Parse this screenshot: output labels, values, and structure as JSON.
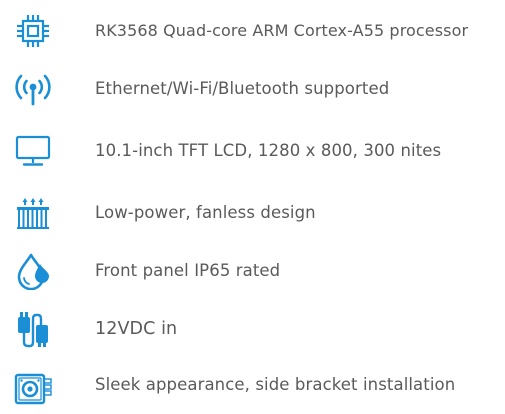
{
  "colors": {
    "icon": "#1a8fd6",
    "text": "#5a5a5a",
    "background": "#ffffff"
  },
  "features": [
    {
      "icon": "processor-chip-icon",
      "label": "RK3568 Quad-core ARM Cortex-A55 processor"
    },
    {
      "icon": "wireless-antenna-icon",
      "label": "Ethernet/Wi-Fi/Bluetooth supported"
    },
    {
      "icon": "monitor-icon",
      "label": "10.1-inch TFT LCD, 1280 x 800, 300 nites"
    },
    {
      "icon": "heatsink-icon",
      "label": "Low-power, fanless design"
    },
    {
      "icon": "water-drop-icon",
      "label": "Front panel IP65 rated"
    },
    {
      "icon": "power-connector-icon",
      "label": "12VDC in"
    },
    {
      "icon": "mounting-bracket-icon",
      "label": "Sleek appearance, side bracket installation"
    }
  ]
}
